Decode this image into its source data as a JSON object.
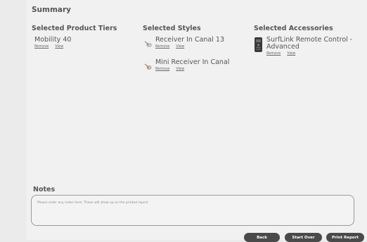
{
  "summary": {
    "title": "Summary"
  },
  "columns": {
    "product_tiers": {
      "heading": "Selected Product Tiers",
      "items": [
        {
          "name": "Mobility 40",
          "remove": "Remove",
          "view": "View"
        }
      ]
    },
    "styles": {
      "heading": "Selected Styles",
      "items": [
        {
          "name": "Receiver In Canal 13",
          "remove": "Remove",
          "view": "View",
          "icon": "hearing-aid-ric-icon"
        },
        {
          "name": "Mini Receiver In Canal",
          "remove": "Remove",
          "view": "View",
          "icon": "hearing-aid-mini-ric-icon"
        }
      ]
    },
    "accessories": {
      "heading": "Selected Accessories",
      "items": [
        {
          "name_line1": "SurfLink Remote Control -",
          "name_line2": "Advanced",
          "remove": "Remove",
          "view": "View",
          "icon": "remote-control-icon"
        }
      ]
    }
  },
  "notes": {
    "title": "Notes",
    "placeholder": "Please enter any notes here. These will show up on the printed report."
  },
  "buttons": {
    "back": "Back",
    "start_over": "Start Over",
    "print_report": "Print Report"
  },
  "colors": {
    "background": "#f1f1f1",
    "button_bg": "#4a4a4a",
    "button_text": "#ffffff",
    "heading_text": "#555555"
  }
}
